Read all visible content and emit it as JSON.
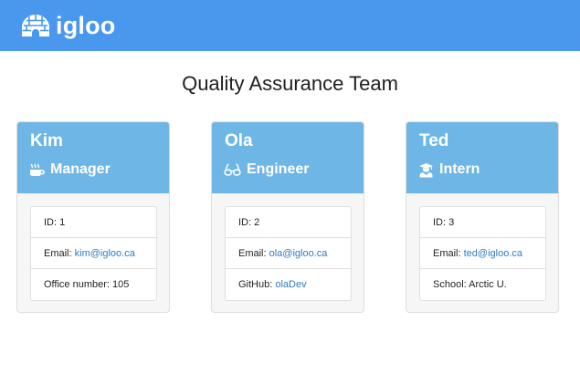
{
  "brand": {
    "name": "igloo"
  },
  "page": {
    "title": "Quality Assurance Team"
  },
  "colors": {
    "navbar": "#4a97ee",
    "card_header": "#6db6e6",
    "link": "#2f7bc2"
  },
  "team": [
    {
      "name": "Kim",
      "role": "Manager",
      "role_icon": "coffee-icon",
      "id_label": "ID:",
      "id": "1",
      "email_label": "Email:",
      "email": "kim@igloo.ca",
      "extra_label": "Office number:",
      "extra_value": "105"
    },
    {
      "name": "Ola",
      "role": "Engineer",
      "role_icon": "glasses-icon",
      "id_label": "ID:",
      "id": "2",
      "email_label": "Email:",
      "email": "ola@igloo.ca",
      "extra_label": "GitHub:",
      "extra_value": "olaDev"
    },
    {
      "name": "Ted",
      "role": "Intern",
      "role_icon": "graduate-icon",
      "id_label": "ID:",
      "id": "3",
      "email_label": "Email:",
      "email": "ted@igloo.ca",
      "extra_label": "School:",
      "extra_value": "Arctic U."
    }
  ]
}
